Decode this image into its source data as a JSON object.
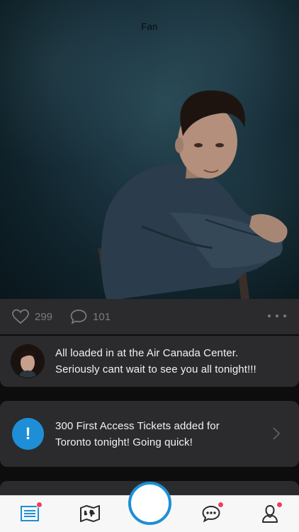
{
  "hero": {
    "title": "Fan"
  },
  "actions": {
    "likes": "299",
    "comments": "101"
  },
  "post": {
    "text": "All loaded in at the Air Canada Center.\nSeriously cant wait to see you all tonight!!!"
  },
  "alert": {
    "icon_symbol": "!",
    "text": "300 First Access Tickets added for\nToronto tonight! Going quick!"
  },
  "tabbar": {
    "items": [
      {
        "name": "feed",
        "icon": "news-list-icon",
        "badge": true
      },
      {
        "name": "map",
        "icon": "world-map-icon",
        "badge": false
      },
      {
        "name": "capture",
        "icon": "record-circle-icon",
        "badge": false
      },
      {
        "name": "chat",
        "icon": "chat-bubble-icon",
        "badge": true
      },
      {
        "name": "profile",
        "icon": "user-icon",
        "badge": true
      }
    ]
  },
  "colors": {
    "accent": "#1e8fd6",
    "badge": "#ef3e5c",
    "card": "#2b2b2d",
    "background": "#0d0d0d"
  }
}
